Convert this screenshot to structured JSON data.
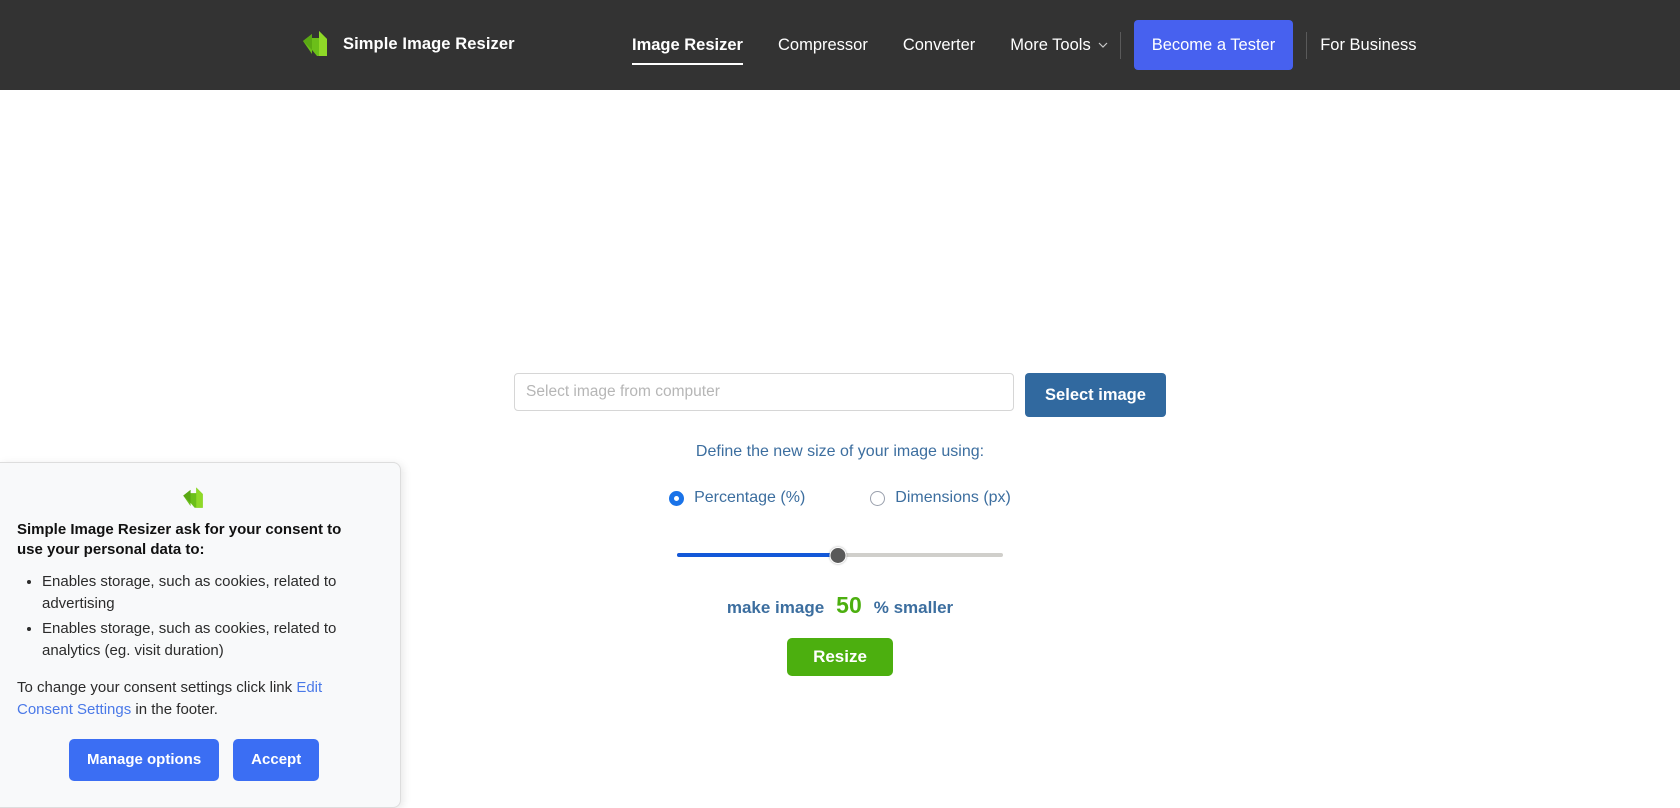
{
  "header": {
    "brand_name": "Simple Image Resizer",
    "logo_icon": "green-arrow-logo-icon",
    "nav": [
      {
        "label": "Image Resizer",
        "active": true
      },
      {
        "label": "Compressor",
        "active": false
      },
      {
        "label": "Converter",
        "active": false
      },
      {
        "label": "More Tools",
        "active": false,
        "has_caret": true
      }
    ],
    "tester_button": "Become a Tester",
    "business_link": "For Business",
    "colors": {
      "bar_background": "#333333",
      "tester_button": "#4761ef",
      "text": "#ffffff"
    }
  },
  "form": {
    "file_input_value": "",
    "file_input_placeholder": "Select image from computer",
    "select_image_button": "Select image",
    "define_label": "Define the new size of your image using:",
    "options": [
      {
        "label": "Percentage (%)",
        "selected": true
      },
      {
        "label": "Dimensions (px)",
        "selected": false
      }
    ],
    "slider": {
      "value": 50,
      "min": 0,
      "max": 100,
      "percent_position": "49.5%"
    },
    "amount_prefix": "make image",
    "amount_value": "50",
    "amount_suffix": "% smaller",
    "resize_button": "Resize",
    "colors": {
      "select_button": "#31699f",
      "label_blue": "#3c6e9f",
      "accent_green": "#4caf0f",
      "slider_fill": "#1358d8",
      "slider_track": "#d0cfcb",
      "slider_thumb": "#595959",
      "radio_selected": "#1a73e8"
    }
  },
  "consent": {
    "logo_icon": "green-arrow-logo-icon",
    "title": "Simple Image Resizer ask for your consent to use your personal data to:",
    "items": [
      "Enables storage, such as cookies, related to advertising",
      "Enables storage, such as cookies, related to analytics (eg. visit duration)"
    ],
    "note_before": "To change your consent settings click link ",
    "note_link": "Edit Consent Settings",
    "note_after": " in the footer.",
    "manage_button": "Manage options",
    "accept_button": "Accept",
    "colors": {
      "background": "#f8f9fa",
      "button": "#3b6ef3",
      "link": "#4a79e8"
    }
  }
}
